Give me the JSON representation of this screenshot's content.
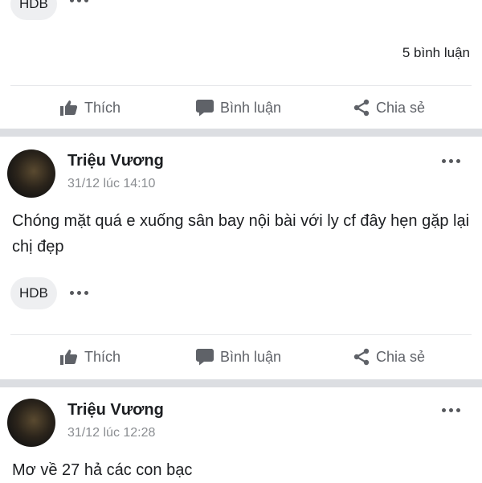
{
  "posts": [
    {
      "tag": "HDB",
      "comment_count": "5 bình luận",
      "actions": {
        "like": "Thích",
        "comment": "Bình luận",
        "share": "Chia sẻ"
      }
    },
    {
      "author": "Triệu Vương",
      "time": "31/12 lúc 14:10",
      "text": "Chóng mặt quá e xuống sân bay nội bài với ly cf đây hẹn gặp lại chị đẹp",
      "tag": "HDB",
      "actions": {
        "like": "Thích",
        "comment": "Bình luận",
        "share": "Chia sẻ"
      }
    },
    {
      "author": "Triệu Vương",
      "time": "31/12 lúc 12:28",
      "text": "Mơ về 27 hả các con bạc"
    }
  ],
  "icons": {
    "like": "thumbs-up-icon",
    "comment": "speech-bubble-icon",
    "share": "share-icon",
    "more": "more-dots-icon"
  },
  "colors": {
    "separator": "#dcdee2",
    "action_text": "#5f6268",
    "tag_bg": "#eeeff1"
  }
}
